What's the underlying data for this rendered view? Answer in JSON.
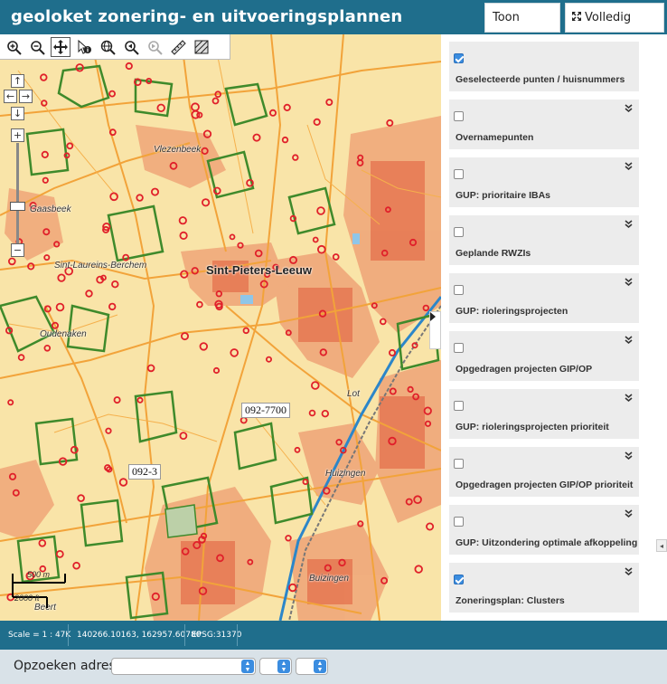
{
  "header": {
    "title": "geoloket zonering- en uitvoeringsplannen",
    "legend_button": "Toon legende",
    "fullscreen_button": "Volledig scherm"
  },
  "map": {
    "toolbar": [
      {
        "name": "zoom-in-tool",
        "icon": "zoom-in-icon"
      },
      {
        "name": "zoom-out-tool",
        "icon": "zoom-out-icon"
      },
      {
        "name": "pan-tool",
        "icon": "pan-icon"
      },
      {
        "name": "identify-tool",
        "icon": "info-icon"
      },
      {
        "name": "zoom-extent-tool",
        "icon": "globe-icon"
      },
      {
        "name": "zoom-previous-tool",
        "icon": "zoom-previous-icon"
      },
      {
        "name": "zoom-next-tool",
        "icon": "zoom-next-icon"
      },
      {
        "name": "measure-line-tool",
        "icon": "ruler-icon"
      },
      {
        "name": "measure-area-tool",
        "icon": "area-icon"
      }
    ],
    "places": {
      "vlezenbeek": "Vlezenbeek",
      "gaasbeek": "Gaasbeek",
      "sint_laureins": "Sint-Laureins-Berchem",
      "sint_pieters": "Sint-Pieters-Leeuw",
      "oudenaken": "Oudenaken",
      "lot": "Lot",
      "huizingen": "Huizingen",
      "buizingen": "Buizingen",
      "beert": "Beert"
    },
    "road_labels": {
      "r1": "092-7700",
      "r2": "092-3"
    },
    "scale": {
      "meters": "500 m",
      "feet": "2000 ft"
    },
    "colors": {
      "background": "#f9e4a8",
      "built_area": "#f0a87a",
      "roads": "#f2a33a",
      "green_zones": "#3f8a2b",
      "points": "#e0202a"
    }
  },
  "layers": [
    {
      "label": "Geselecteerde punten / huisnummers",
      "checked": true,
      "expandable": false
    },
    {
      "label": "Overnamepunten",
      "checked": false,
      "expandable": true
    },
    {
      "label": "GUP: prioritaire IBAs",
      "checked": false,
      "expandable": true
    },
    {
      "label": "Geplande RWZIs",
      "checked": false,
      "expandable": true
    },
    {
      "label": "GUP: rioleringsprojecten",
      "checked": false,
      "expandable": true
    },
    {
      "label": "Opgedragen projecten GIP/OP",
      "checked": false,
      "expandable": true
    },
    {
      "label": "GUP: rioleringsprojecten prioriteit",
      "checked": false,
      "expandable": true
    },
    {
      "label": "Opgedragen projecten GIP/OP prioriteit",
      "checked": false,
      "expandable": true
    },
    {
      "label": "GUP: Uitzondering optimale afkoppeling",
      "checked": false,
      "expandable": true
    },
    {
      "label": "Zoneringsplan: Clusters",
      "checked": true,
      "expandable": true
    }
  ],
  "status": {
    "scale": "Scale = 1 : 47K",
    "coords": "140266.10163, 162957.60780",
    "epsg": "EPSG:31370"
  },
  "search": {
    "label": "Opzoeken adres:",
    "street_value": "",
    "number_value": "",
    "extra_value": ""
  }
}
